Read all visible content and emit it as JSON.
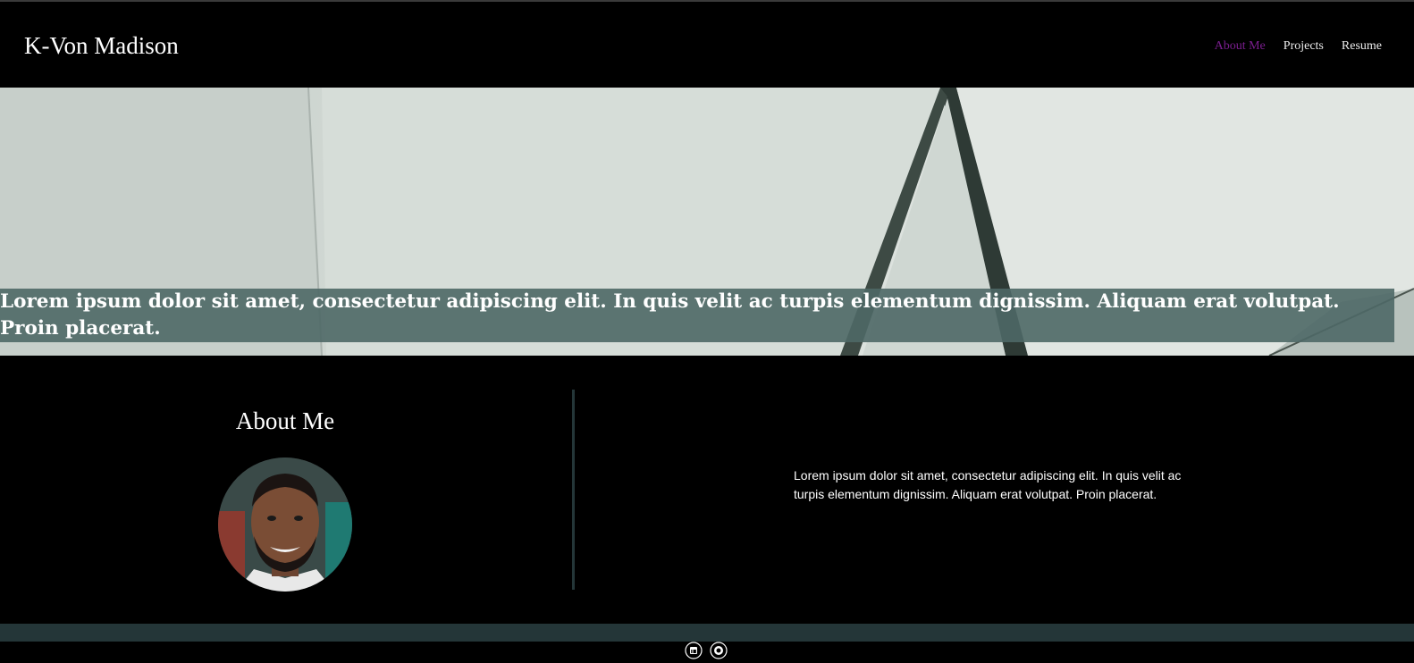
{
  "header": {
    "brand": "K-Von Madison",
    "nav": [
      {
        "label": "About Me",
        "active": true
      },
      {
        "label": "Projects",
        "active": false
      },
      {
        "label": "Resume",
        "active": false
      }
    ]
  },
  "hero": {
    "headline": "Lorem ipsum dolor sit amet, consectetur adipiscing elit. In quis velit ac turpis elementum dignissim. Aliquam erat volutpat. Proin placerat."
  },
  "about": {
    "title": "About Me",
    "body": "Lorem ipsum dolor sit amet, consectetur adipiscing elit. In quis velit ac turpis elementum dignissim. Aliquam erat volutpat. Proin placerat."
  },
  "footer": {
    "social": [
      {
        "icon": "linkedin-icon"
      },
      {
        "icon": "github-icon"
      }
    ]
  },
  "colors": {
    "active_nav": "#7b1e8f",
    "banner": "#4e6866",
    "accent_bar": "#243638"
  }
}
